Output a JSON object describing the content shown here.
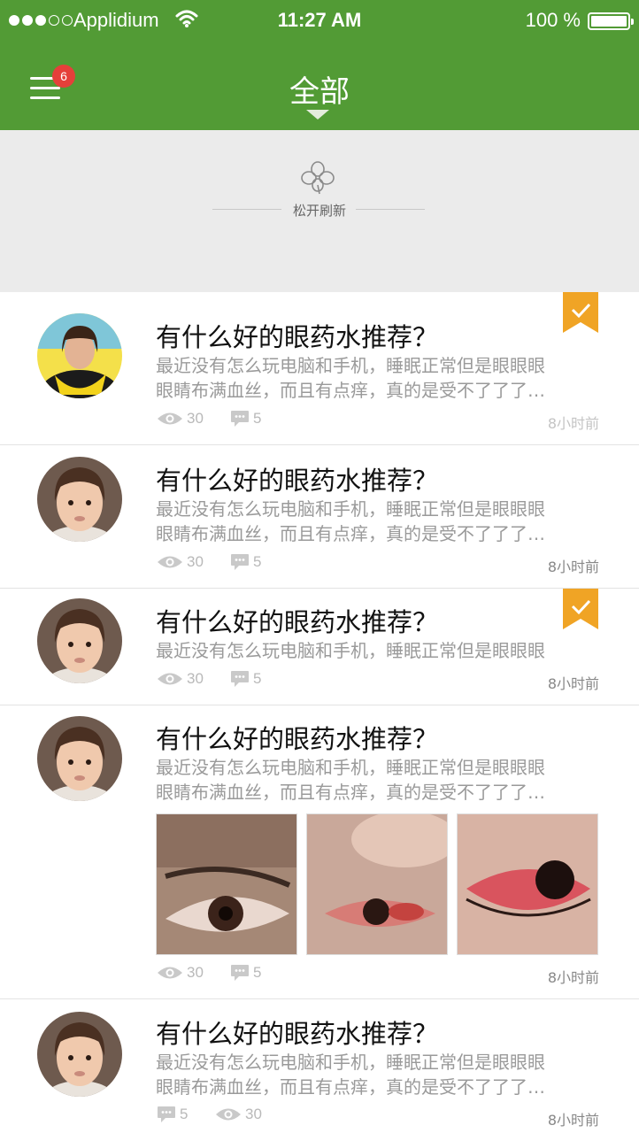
{
  "status_bar": {
    "carrier": "Applidium",
    "time": "11:27 AM",
    "battery": "100 %"
  },
  "header": {
    "title": "全部",
    "badge_count": "6",
    "accent_color": "#529b35"
  },
  "refresh": {
    "label": "松开刷新"
  },
  "posts": [
    {
      "title": "有什么好的眼药水推荐？",
      "excerpt_lines": [
        "最近没有怎么玩电脑和手机，睡眠正常但是眼眼眼",
        "眼睛布满血丝，而且有点痒，真的是受不了了了…"
      ],
      "views": "30",
      "comments": "5",
      "time": "8小时前",
      "bookmarked": true
    },
    {
      "title": "有什么好的眼药水推荐？",
      "excerpt_lines": [
        "最近没有怎么玩电脑和手机，睡眠正常但是眼眼眼",
        "眼睛布满血丝，而且有点痒，真的是受不了了了…"
      ],
      "views": "30",
      "comments": "5",
      "time": "8小时前",
      "bookmarked": false
    },
    {
      "title": "有什么好的眼药水推荐？",
      "excerpt_lines": [
        "最近没有怎么玩电脑和手机，睡眠正常但是眼眼眼"
      ],
      "views": "30",
      "comments": "5",
      "time": "8小时前",
      "bookmarked": true
    },
    {
      "title": "有什么好的眼药水推荐？",
      "excerpt_lines": [
        "最近没有怎么玩电脑和手机，睡眠正常但是眼眼眼",
        "眼睛布满血丝，而且有点痒，真的是受不了了了…"
      ],
      "views": "30",
      "comments": "5",
      "time": "8小时前",
      "bookmarked": false,
      "images": [
        "eye-photo-1",
        "eye-photo-2",
        "eye-photo-3"
      ]
    },
    {
      "title": "有什么好的眼药水推荐？",
      "excerpt_lines": [
        "最近没有怎么玩电脑和手机，睡眠正常但是眼眼眼",
        "眼睛布满血丝，而且有点痒，真的是受不了了了…"
      ],
      "views": "30",
      "comments": "5",
      "time": "8小时前",
      "bookmarked": false
    }
  ]
}
